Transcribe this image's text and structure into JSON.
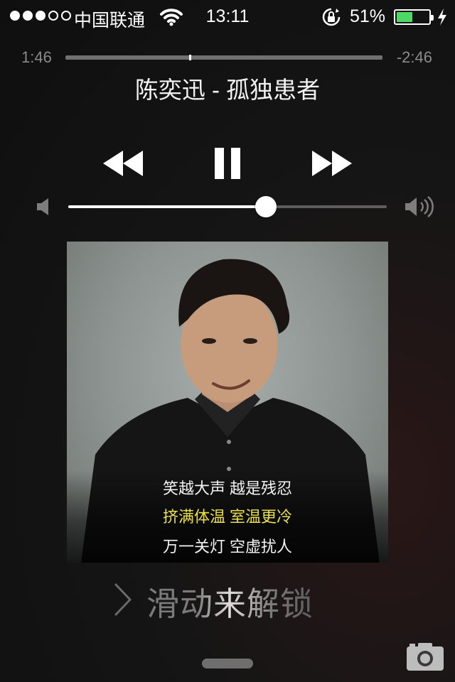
{
  "status_bar": {
    "carrier": "中国联通",
    "time": "13:11",
    "battery_percent": "51%",
    "battery_level": 0.51,
    "battery_color": "#4cd964",
    "signal_bars": 3,
    "signal_total": 5
  },
  "player": {
    "elapsed": "1:46",
    "remaining": "-2:46",
    "progress": 0.39,
    "song_title": "陈奕迅 - 孤独患者",
    "volume": 0.62
  },
  "lyrics": {
    "line1": "笑越大声 越是残忍",
    "line2": "挤满体温 室温更冷",
    "line3": "万一关灯 空虚扰人",
    "highlight_color": "#ece04a"
  },
  "lock": {
    "slide_text": "滑动来解锁"
  },
  "icons": {
    "signal": "signal-dots-icon",
    "wifi": "wifi-icon",
    "rotation_lock": "rotation-lock-icon",
    "battery": "battery-icon",
    "charging": "charging-bolt-icon",
    "previous": "rewind-icon",
    "pause": "pause-icon",
    "next": "fast-forward-icon",
    "volume_min": "speaker-low-icon",
    "volume_max": "speaker-high-icon",
    "unlock": "chevron-right-icon",
    "camera": "camera-icon"
  }
}
